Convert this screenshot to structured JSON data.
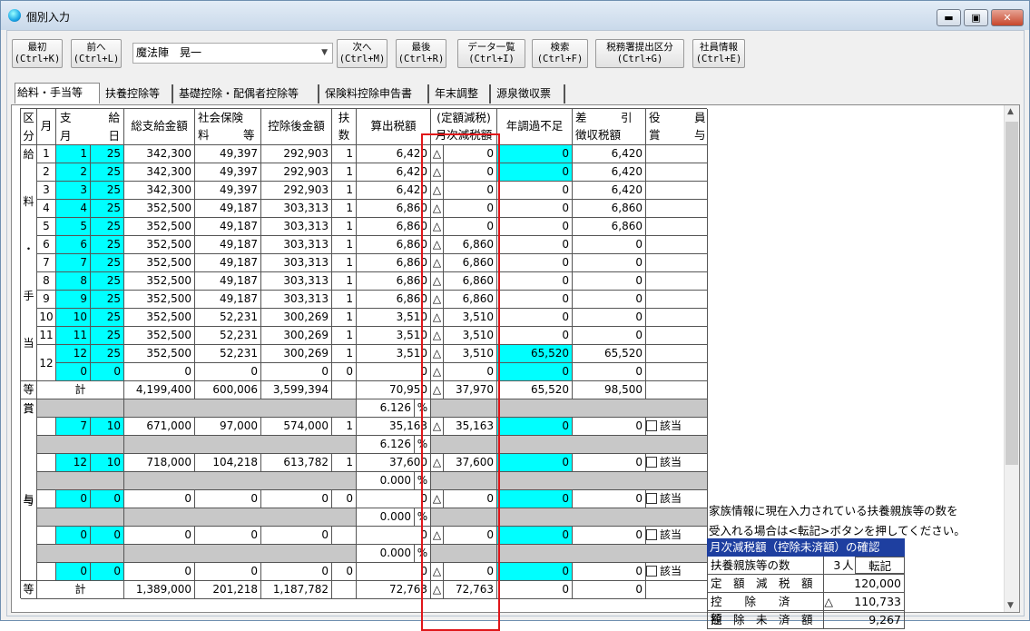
{
  "window": {
    "title": "個別入力",
    "min": "▬",
    "max": "▣",
    "close": "✕"
  },
  "toolbar": {
    "first": [
      "最初",
      "(Ctrl+K)"
    ],
    "prev": [
      "前へ",
      "(Ctrl+L)"
    ],
    "employee": "魔法陣　晃一",
    "next": [
      "次へ",
      "(Ctrl+M)"
    ],
    "last": [
      "最後",
      "(Ctrl+R)"
    ],
    "list": [
      "データ一覧",
      "(Ctrl+I)"
    ],
    "search": [
      "検索",
      "(Ctrl+F)"
    ],
    "taxoffice": [
      "税務署提出区分",
      "(Ctrl+G)"
    ],
    "empinfo": [
      "社員情報",
      "(Ctrl+E)"
    ]
  },
  "tabs": [
    "給料・手当等",
    "扶養控除等",
    "基礎控除・配偶者控除等",
    "保険料控除申告書",
    "年末調整",
    "源泉徴収票"
  ],
  "headers": {
    "kubun": "区分",
    "tsuki": "月",
    "shi": "支",
    "gatsu": "月",
    "kyu": "給",
    "hi": "日",
    "sougaku": "総支給金額",
    "shakai1": "社会保険",
    "shakai2": "料　　　等",
    "koujogo": "控除後金額",
    "fuyo1": "扶",
    "fuyo2": "数",
    "sanshutsu": "算出税額",
    "teigaku1": "(定額減税)",
    "teigaku2": "月次減税額",
    "nenchou": "年調過不足",
    "sashi1": "差　　　引",
    "sashi2": "徴収税額",
    "yakuin1": "役　　　員",
    "yakuin2": "賞　　　与"
  },
  "salary_section_label": [
    "給",
    "料",
    "・",
    "手",
    "当",
    "等"
  ],
  "salary_rows": [
    [
      "1",
      "1",
      "25",
      "342,300",
      "49,397",
      "292,903",
      "1",
      "6,420",
      "△",
      "0",
      "0",
      "6,420"
    ],
    [
      "2",
      "2",
      "25",
      "342,300",
      "49,397",
      "292,903",
      "1",
      "6,420",
      "△",
      "0",
      "0",
      "6,420"
    ],
    [
      "3",
      "3",
      "25",
      "342,300",
      "49,397",
      "292,903",
      "1",
      "6,420",
      "△",
      "0",
      "0",
      "6,420"
    ],
    [
      "4",
      "4",
      "25",
      "352,500",
      "49,187",
      "303,313",
      "1",
      "6,860",
      "△",
      "0",
      "0",
      "6,860"
    ],
    [
      "5",
      "5",
      "25",
      "352,500",
      "49,187",
      "303,313",
      "1",
      "6,860",
      "△",
      "0",
      "0",
      "6,860"
    ],
    [
      "6",
      "6",
      "25",
      "352,500",
      "49,187",
      "303,313",
      "1",
      "6,860",
      "△",
      "6,860",
      "0",
      "0"
    ],
    [
      "7",
      "7",
      "25",
      "352,500",
      "49,187",
      "303,313",
      "1",
      "6,860",
      "△",
      "6,860",
      "0",
      "0"
    ],
    [
      "8",
      "8",
      "25",
      "352,500",
      "49,187",
      "303,313",
      "1",
      "6,860",
      "△",
      "6,860",
      "0",
      "0"
    ],
    [
      "9",
      "9",
      "25",
      "352,500",
      "49,187",
      "303,313",
      "1",
      "6,860",
      "△",
      "6,860",
      "0",
      "0"
    ],
    [
      "10",
      "10",
      "25",
      "352,500",
      "52,231",
      "300,269",
      "1",
      "3,510",
      "△",
      "3,510",
      "0",
      "0"
    ],
    [
      "11",
      "11",
      "25",
      "352,500",
      "52,231",
      "300,269",
      "1",
      "3,510",
      "△",
      "3,510",
      "0",
      "0"
    ],
    [
      "12",
      "12",
      "25",
      "352,500",
      "52,231",
      "300,269",
      "1",
      "3,510",
      "△",
      "3,510",
      "65,520",
      "65,520"
    ],
    [
      "",
      "0",
      "0",
      "0",
      "0",
      "0",
      "0",
      "0",
      "△",
      "0",
      "0",
      "0"
    ]
  ],
  "salary_total": [
    "計",
    "4,199,400",
    "600,006",
    "3,599,394",
    "",
    "70,950",
    "△",
    "37,970",
    "65,520",
    "98,500"
  ],
  "bonus_section_label": [
    "賞",
    "与",
    "等"
  ],
  "bonus_rows": [
    {
      "rate": "6.126",
      "pct": "%",
      "m": "7",
      "d": "10",
      "total": "671,000",
      "ins": "97,000",
      "after": "574,000",
      "dep": "1",
      "tax": "35,163",
      "tri": "△",
      "reduce": "35,163",
      "adj": "0",
      "net": "0",
      "chk": "該当"
    },
    {
      "rate": "6.126",
      "pct": "%",
      "m": "12",
      "d": "10",
      "total": "718,000",
      "ins": "104,218",
      "after": "613,782",
      "dep": "1",
      "tax": "37,600",
      "tri": "△",
      "reduce": "37,600",
      "adj": "0",
      "net": "0",
      "chk": "該当"
    },
    {
      "rate": "0.000",
      "pct": "%",
      "m": "0",
      "d": "0",
      "total": "0",
      "ins": "0",
      "after": "0",
      "dep": "0",
      "tax": "0",
      "tri": "△",
      "reduce": "0",
      "adj": "0",
      "net": "0",
      "chk": "該当"
    },
    {
      "rate": "0.000",
      "pct": "%",
      "m": "0",
      "d": "0",
      "total": "0",
      "ins": "0",
      "after": "0",
      "dep": "",
      "tax": "0",
      "tri": "△",
      "reduce": "0",
      "adj": "0",
      "net": "0",
      "chk": "該当"
    },
    {
      "rate": "0.000",
      "pct": "%",
      "m": "0",
      "d": "0",
      "total": "0",
      "ins": "0",
      "after": "0",
      "dep": "0",
      "tax": "0",
      "tri": "△",
      "reduce": "0",
      "adj": "0",
      "net": "0",
      "chk": "該当"
    }
  ],
  "bonus_total": [
    "計",
    "1,389,000",
    "201,218",
    "1,187,782",
    "",
    "72,763",
    "△",
    "72,763",
    "0",
    "0"
  ],
  "note": [
    "家族情報に現在入力されている扶養親族等の数を",
    "受入れる場合は<転記>ボタンを押してください。"
  ],
  "confirm": {
    "title": "月次減税額（控除未済額）の確認",
    "dep_label": "扶養親族等の数",
    "dep_value": "3",
    "dep_unit": "人",
    "transfer": "転記",
    "fixed_label": "定　額　減　税　額",
    "fixed_value": "120,000",
    "done_label": "控　　除　　済　　額",
    "done_tri": "△",
    "done_value": "110,733",
    "rem_label": "控　除　未　済　額",
    "rem_value": "9,267"
  },
  "colors": {
    "cyan": "#00ffff",
    "red": "#e0161a",
    "header_blue": "#1e3fa0"
  }
}
